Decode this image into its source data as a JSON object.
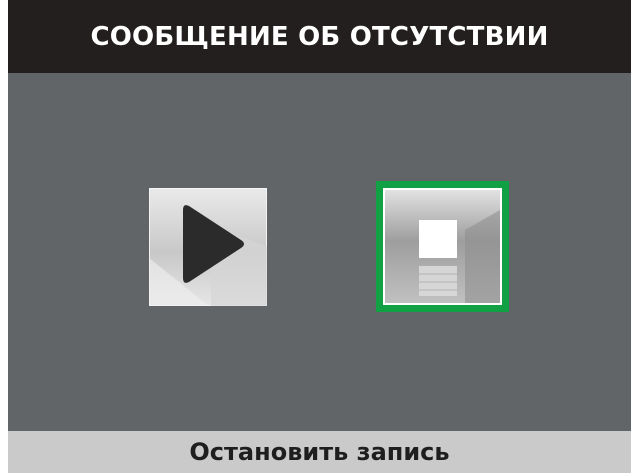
{
  "header": {
    "title": "СООБЩЕНИЕ ОБ ОТСУТСТВИИ"
  },
  "controls": {
    "play": {
      "icon": "play-icon"
    },
    "stop_record": {
      "icon": "stop-icon",
      "selected": true
    }
  },
  "footer": {
    "status_label": "Остановить запись"
  },
  "colors": {
    "background": "#626568",
    "title_bar": "#221f1e",
    "status_bar": "#cacaca",
    "selection_border": "#12a045"
  }
}
